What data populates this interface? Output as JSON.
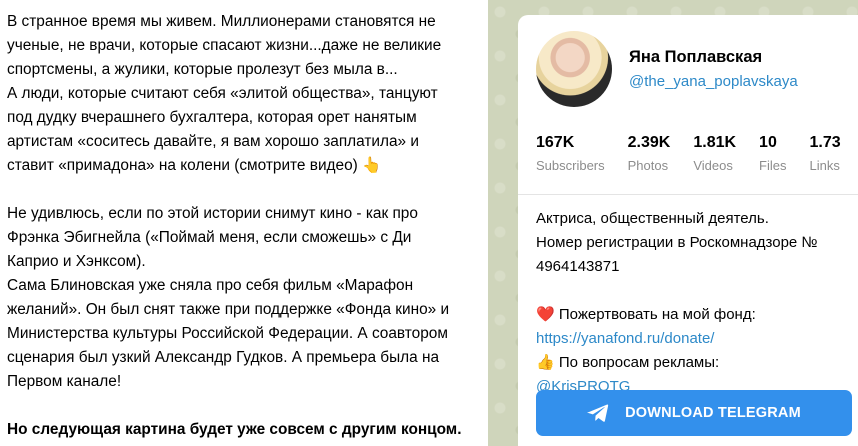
{
  "post": {
    "paragraphs": [
      [
        "В странное время мы живем. Миллионерами становятся не",
        "ученые, не врачи, которые спасают жизни...даже не великие",
        "спортсмены, а жулики, которые пролезут без мыла в...",
        "А люди, которые считают себя «элитой общества», танцуют",
        "под дудку вчерашнего бухгалтера, которая орет нанятым",
        "артистам «соситесь давайте, я вам хорошо заплатила» и",
        "ставит «примадона» на колени (смотрите видео) 👆"
      ],
      [
        "Не удивлюсь, если по этой истории снимут кино - как про",
        "Фрэнка Эбигнейла («Поймай меня, если сможешь» с Ди",
        "Каприо и Хэнксом).",
        "Сама Блиновская уже сняла про себя фильм «Марафон",
        "желаний». Он был снят также при поддержке «Фонда кино» и",
        "Министерства культуры Российской Федерации. А соавтором",
        "сценария был узкий Александр Гудков. А премьера была на",
        "Первом канале!"
      ]
    ],
    "bold_line": "Но следующая картина будет уже совсем с другим концом."
  },
  "channel": {
    "avatar_icon": "avatar-photo",
    "name": "Яна Поплавская",
    "username": "@the_yana_poplavskaya",
    "stats": [
      {
        "value": "167K",
        "label": "Subscribers"
      },
      {
        "value": "2.39K",
        "label": "Photos"
      },
      {
        "value": "1.81K",
        "label": "Videos"
      },
      {
        "value": "10",
        "label": "Files"
      },
      {
        "value": "1.73",
        "label": "Links"
      }
    ],
    "description": {
      "line1": "Актриса, общественный деятель.",
      "line2": "Номер регистрации в Роскомнадзоре №",
      "line3": "4964143871",
      "donate_icon": "❤️",
      "donate_text": "Пожертвовать на мой фонд:",
      "donate_link": "https://yanafond.ru/donate/",
      "ads_icon": "👍",
      "ads_text": "По вопросам рекламы:",
      "ads_link": "@KrisPROTG"
    },
    "download_button": "DOWNLOAD TELEGRAM",
    "button_color": "#3390ec",
    "link_color": "#2d89c8"
  }
}
